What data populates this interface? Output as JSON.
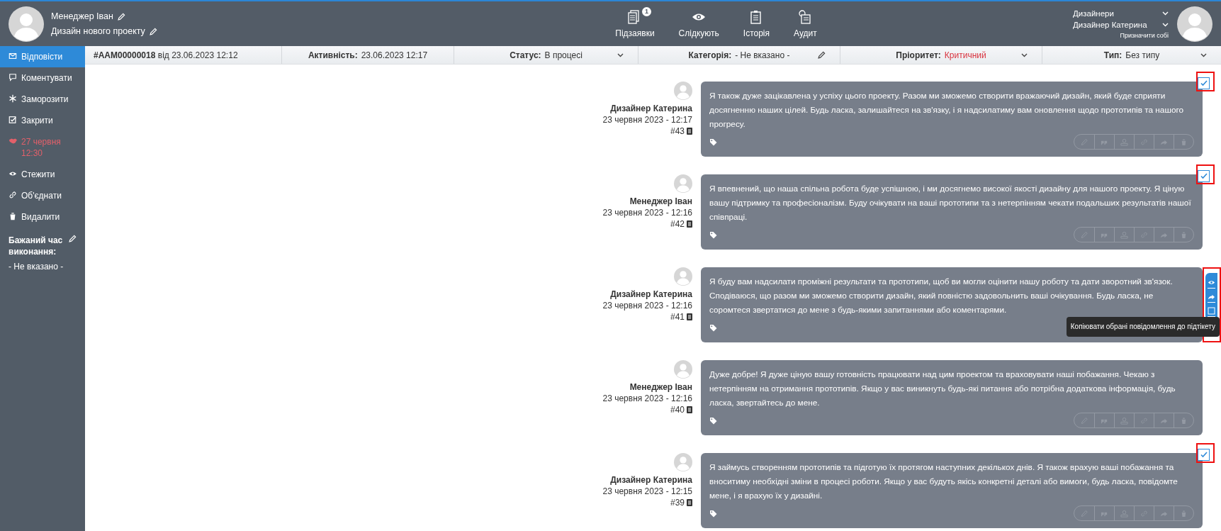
{
  "header": {
    "user": "Менеджер Іван",
    "project": "Дизайн нового проекту",
    "nav": [
      {
        "label": "Підзаявки",
        "badge": "1"
      },
      {
        "label": "Слідкують"
      },
      {
        "label": "Історія"
      },
      {
        "label": "Аудит"
      }
    ],
    "group": "Дизайнери",
    "assignee": "Дизайнер Катерина",
    "assign_self": "Призначити собі"
  },
  "infobar": {
    "ticket": "#AAM00000018",
    "created": "від 23.06.2023 12:12",
    "fields": [
      {
        "label": "Активність:",
        "value": "23.06.2023 12:17",
        "kind": "plain"
      },
      {
        "label": "Статус:",
        "value": "В процесі",
        "kind": "dropdown"
      },
      {
        "label": "Категорія:",
        "value": "- Не вказано -",
        "kind": "edit"
      },
      {
        "label": "Пріоритет:",
        "value": "Критичний",
        "kind": "dropdown",
        "color": "#d9333f"
      },
      {
        "label": "Тип:",
        "value": "Без типу",
        "kind": "dropdown"
      }
    ]
  },
  "sidebar": {
    "items": [
      {
        "label": "Відповісти",
        "selected": true,
        "kind": "action"
      },
      {
        "label": "Коментувати",
        "selected": false,
        "kind": "action"
      },
      {
        "label": "Заморозити",
        "selected": false,
        "kind": "action"
      },
      {
        "label": "Закрити",
        "selected": false,
        "kind": "action"
      },
      {
        "label": "27 червня 12:30",
        "selected": false,
        "kind": "date"
      },
      {
        "label": "Стежити",
        "selected": false,
        "kind": "action"
      },
      {
        "label": "Об'єднати",
        "selected": false,
        "kind": "action"
      },
      {
        "label": "Видалити",
        "selected": false,
        "kind": "action"
      }
    ],
    "due_label": "Бажаний час виконання:",
    "due_value": "- Не вказано -"
  },
  "messages": [
    {
      "author": "Дизайнер Катерина",
      "date": "23 червня 2023 - 12:17",
      "number": "#43",
      "text": "Я також дуже зацікавлена у успіху цього проекту. Разом ми зможемо створити вражаючий дизайн, який буде сприяти досягненню наших цілей. Будь ласка, залишайтеся на зв'язку, і я надсилатиму вам оновлення щодо прототипів та нашого прогресу.",
      "selected": true,
      "highlighted": true
    },
    {
      "author": "Менеджер Іван",
      "date": "23 червня 2023 - 12:16",
      "number": "#42",
      "text": "Я впевнений, що наша спільна робота буде успішною, і ми досягнемо високої якості дизайну для нашого проекту. Я ціную вашу підтримку та професіоналізм. Буду очікувати на ваші прототипи та з нетерпінням чекати подальших результатів нашої співпраці.",
      "selected": true,
      "highlighted": true
    },
    {
      "author": "Дизайнер Катерина",
      "date": "23 червня 2023 - 12:16",
      "number": "#41",
      "text": "Я буду вам надсилати проміжні результати та прототипи, щоб ви могли оцінити нашу роботу та дати зворотний зв'язок. Сподіваюся, що разом ми зможемо створити дизайн, який повністю задовольнить ваші очікування. Будь ласка, не соромтеся звертатися до мене з будь-якими запитаннями або коментарями.",
      "selected": false,
      "highlighted": true,
      "toolbar": {
        "tooltip": "Копіювати обрані повідомлення до підтікету"
      }
    },
    {
      "author": "Менеджер Іван",
      "date": "23 червня 2023 - 12:16",
      "number": "#40",
      "text": "Дуже добре! Я дуже ціную вашу готовність працювати над цим проектом та враховувати наші побажання. Чекаю з нетерпінням на отримання прототипів. Якщо у вас виникнуть будь-які питання або потрібна додаткова інформація, будь ласка, звертайтесь до мене.",
      "selected": false,
      "highlighted": false
    },
    {
      "author": "Дизайнер Катерина",
      "date": "23 червня 2023 - 12:15",
      "number": "#39",
      "text": "Я займусь створенням прототипів та підготую їх протягом наступних декількох днів. Я також врахую ваші побажання та вноситиму необхідні зміни в процесі роботи. Якщо у вас будуть якісь конкретні деталі або вимоги, будь ласка, повідомте мене, і я врахую їх у дизайні.",
      "selected": true,
      "highlighted": true
    }
  ]
}
